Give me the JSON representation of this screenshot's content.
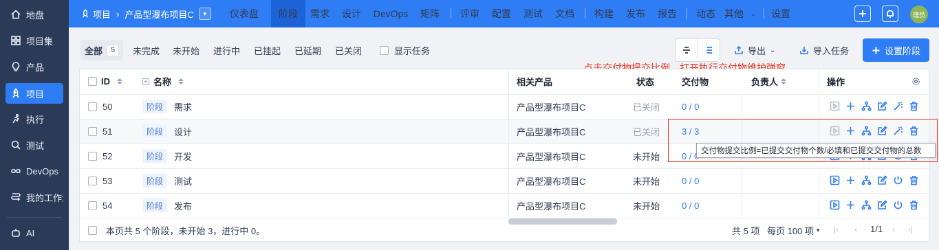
{
  "sidebar": {
    "items": [
      {
        "label": "地盘",
        "icon": "home-icon"
      },
      {
        "label": "项目集",
        "icon": "grid-icon"
      },
      {
        "label": "产品",
        "icon": "bulb-icon"
      },
      {
        "label": "项目",
        "icon": "rocket-icon",
        "active": true
      },
      {
        "label": "执行",
        "icon": "run-icon"
      },
      {
        "label": "测试",
        "icon": "magnifier-icon"
      },
      {
        "label": "DevOps",
        "icon": "infinity-icon"
      },
      {
        "label": "我的工作流",
        "icon": "workflow-icon"
      },
      {
        "label": "AI",
        "icon": "robot-icon"
      }
    ]
  },
  "topbar": {
    "breadcrumb_root": "项目",
    "breadcrumb_project": "产品型瀑布项目C",
    "nav": [
      "仪表盘",
      "阶段",
      "需求",
      "设计",
      "DevOps",
      "矩阵",
      "评审",
      "配置",
      "测试",
      "文档",
      "构建",
      "发布",
      "报告",
      "动态",
      "其他",
      "设置"
    ],
    "active_nav": "阶段",
    "avatar_text": "理员"
  },
  "filters": {
    "all_label": "全部",
    "all_count": "5",
    "items": [
      "未完成",
      "未开始",
      "进行中",
      "已挂起",
      "已延期",
      "已关闭"
    ],
    "show_tasks": "显示任务"
  },
  "toolbar": {
    "export": "导出",
    "import": "导入任务",
    "set_stage": "设置阶段"
  },
  "annotation": "点击交付物提交比例，打开执行交付物维护弹窗",
  "table": {
    "headers": {
      "id": "ID",
      "name": "名称",
      "product": "相关产品",
      "status": "状态",
      "deliverable": "交付物",
      "owner": "负责人",
      "actions": "操作"
    },
    "rows": [
      {
        "id": "50",
        "tag": "阶段",
        "name": "需求",
        "product": "产品型瀑布项目C",
        "status": "已关闭",
        "status_muted": true,
        "deliverable": "0 / 0"
      },
      {
        "id": "51",
        "tag": "阶段",
        "name": "设计",
        "product": "产品型瀑布项目C",
        "status": "已关闭",
        "status_muted": true,
        "deliverable": "3 / 3"
      },
      {
        "id": "52",
        "tag": "阶段",
        "name": "开发",
        "product": "产品型瀑布项目C",
        "status": "未开始",
        "status_muted": false,
        "deliverable": "0 / 0"
      },
      {
        "id": "53",
        "tag": "阶段",
        "name": "测试",
        "product": "产品型瀑布项目C",
        "status": "未开始",
        "status_muted": false,
        "deliverable": "0 / 0"
      },
      {
        "id": "54",
        "tag": "阶段",
        "name": "发布",
        "product": "产品型瀑布项目C",
        "status": "未开始",
        "status_muted": false,
        "deliverable": "0 / 0"
      }
    ]
  },
  "tooltip": "交付物提交比例=已提交交付物个数/必填和已提交交付物的总数",
  "footer": {
    "summary": "本页共 5 个阶段，未开始 3，进行中 0。",
    "total": "共 5 项",
    "per_page": "每页 100 项",
    "page": "1/1"
  },
  "colors": {
    "brand": "#2e7df5",
    "sidebar": "#2b3a56",
    "annotation": "#e8331e"
  }
}
